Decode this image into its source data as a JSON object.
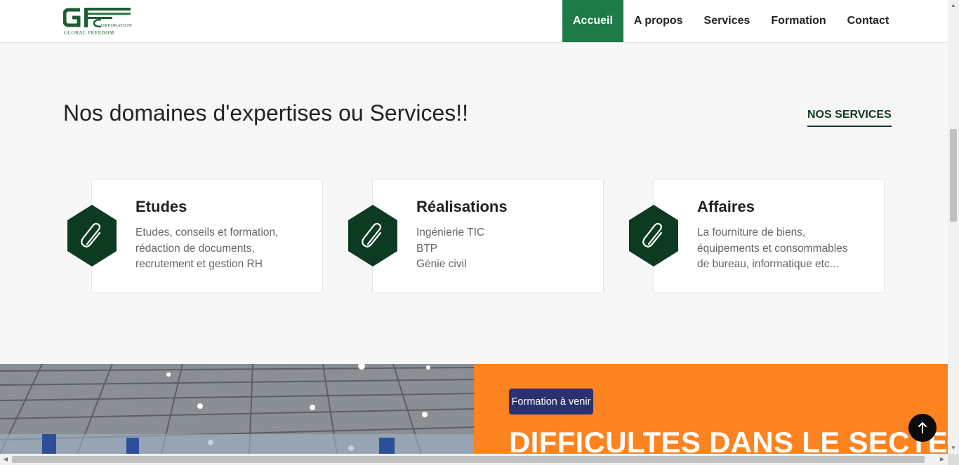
{
  "header": {
    "logo": {
      "letters": "GF",
      "line1": "GLOBAL FREEDOM",
      "line2": "ORPORATION"
    },
    "nav": [
      {
        "label": "Accueil",
        "active": true
      },
      {
        "label": "A propos",
        "active": false
      },
      {
        "label": "Services",
        "active": false
      },
      {
        "label": "Formation",
        "active": false
      },
      {
        "label": "Contact",
        "active": false
      }
    ]
  },
  "services": {
    "title": "Nos domaines d'expertises ou Services!!",
    "link": "NOS SERVICES",
    "cards": [
      {
        "title": "Etudes",
        "icon": "paperclip-icon",
        "lines": [
          "Etudes, conseils et formation,",
          "rédaction de documents,",
          "recrutement et gestion RH"
        ]
      },
      {
        "title": "Réalisations",
        "icon": "paperclip-icon",
        "lines": [
          "Ingénierie TIC",
          "BTP",
          "Génie civil"
        ]
      },
      {
        "title": "Affaires",
        "icon": "paperclip-icon",
        "lines": [
          "La fourniture de biens,",
          "équipements et consommables",
          "de bureau, informatique etc..."
        ]
      }
    ]
  },
  "formation": {
    "badge": "Formation à venir",
    "headline": "DIFFICULTES DANS LE SECTEUR"
  },
  "back_to_top": {
    "icon": "arrow-up-icon"
  },
  "colors": {
    "nav_active": "#1e7a46",
    "hexagon": "#0d3b22",
    "orange": "#fd8320",
    "badge": "#2a3170"
  }
}
